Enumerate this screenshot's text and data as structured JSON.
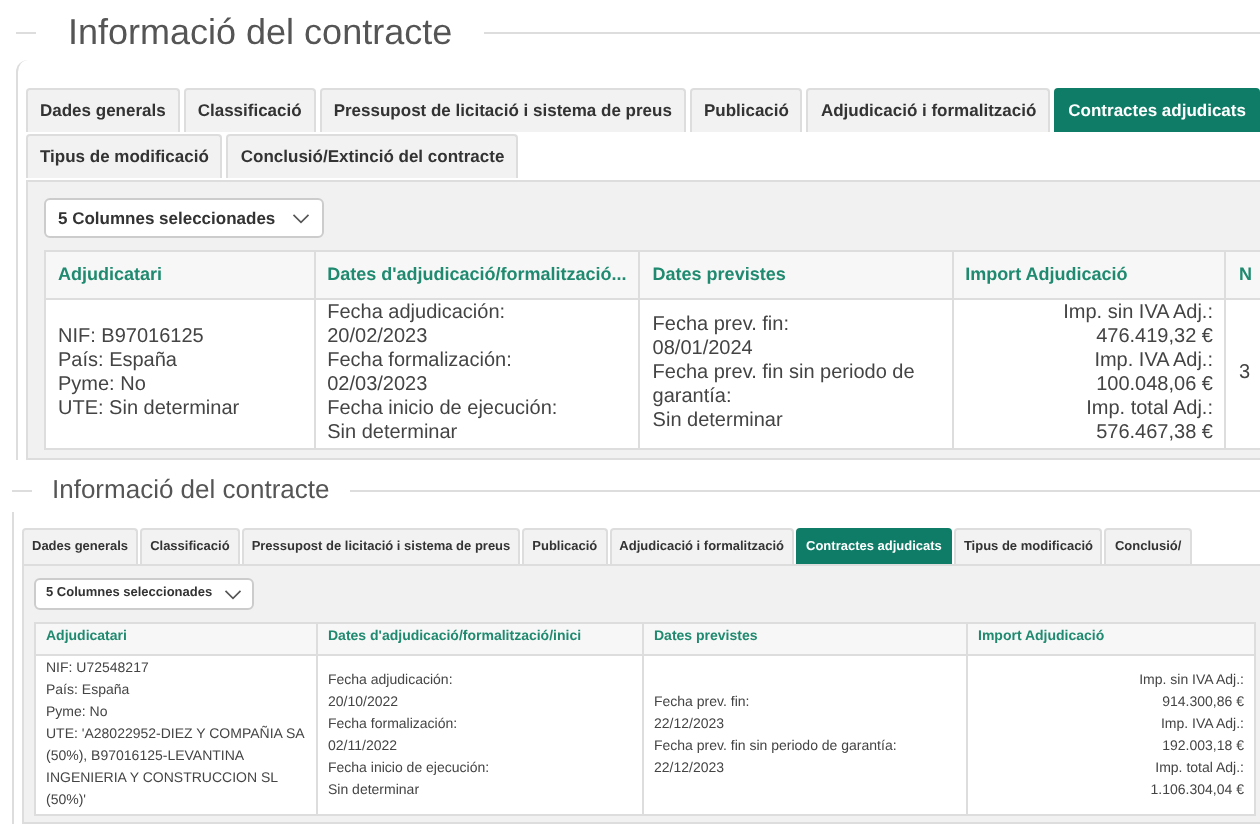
{
  "panels": [
    {
      "title": "Informació del contracte",
      "tabs": [
        {
          "label": "Dades generals",
          "selected": false
        },
        {
          "label": "Classificació",
          "selected": false
        },
        {
          "label": "Pressupost de licitació i sistema de preus",
          "selected": false
        },
        {
          "label": "Publicació",
          "selected": false
        },
        {
          "label": "Adjudicació i formalització",
          "selected": false
        },
        {
          "label": "Contractes adjudicats",
          "selected": true
        },
        {
          "label": "Tipus de modificació",
          "selected": false
        },
        {
          "label": "Conclusió/Extinció del contracte",
          "selected": false
        }
      ],
      "column_selector": "5 Columnes seleccionades",
      "table": {
        "columns": [
          "Adjudicatari",
          "Dates d'adjudicació/formalització...",
          "Dates previstes",
          "Import Adjudicació",
          "N"
        ],
        "rows": [
          [
            [
              "NIF: B97016125",
              "País: España",
              "Pyme: No",
              "UTE: Sin determinar"
            ],
            [
              "Fecha adjudicación:",
              "20/02/2023",
              "Fecha formalización:",
              "02/03/2023",
              "Fecha inicio de ejecución:",
              "Sin determinar"
            ],
            [
              "Fecha prev. fin:",
              "08/01/2024",
              "Fecha prev. fin sin periodo de garantía:",
              "Sin determinar"
            ],
            [
              "Imp. sin IVA Adj.:",
              "476.419,32 €",
              "Imp. IVA Adj.:",
              "100.048,06 €",
              "Imp. total Adj.:",
              "576.467,38 €"
            ],
            [
              "3"
            ]
          ]
        ]
      }
    },
    {
      "title": "Informació del contracte",
      "tabs": [
        {
          "label": "Dades generals",
          "selected": false
        },
        {
          "label": "Classificació",
          "selected": false
        },
        {
          "label": "Pressupost de licitació i sistema de preus",
          "selected": false
        },
        {
          "label": "Publicació",
          "selected": false
        },
        {
          "label": "Adjudicació i formalització",
          "selected": false
        },
        {
          "label": "Contractes adjudicats",
          "selected": true
        },
        {
          "label": "Tipus de modificació",
          "selected": false
        },
        {
          "label": "Conclusió/",
          "selected": false
        }
      ],
      "column_selector": "5 Columnes seleccionades",
      "table": {
        "columns": [
          "Adjudicatari",
          "Dates d'adjudicació/formalització/inici",
          "Dates previstes",
          "Import Adjudicació"
        ],
        "rows": [
          [
            [
              "NIF: U72548217",
              "País: España",
              "Pyme: No",
              "UTE: 'A28022952-DIEZ Y COMPAÑIA SA (50%), B97016125-LEVANTINA INGENIERIA Y CONSTRUCCION SL (50%)'"
            ],
            [
              "Fecha adjudicación:",
              "20/10/2022",
              "Fecha formalización:",
              "02/11/2022",
              "Fecha inicio de ejecución:",
              "Sin determinar"
            ],
            [
              "Fecha prev. fin:",
              "22/12/2023",
              "Fecha prev. fin sin periodo de garantía:",
              "22/12/2023"
            ],
            [
              "Imp. sin IVA Adj.:",
              "914.300,86 €",
              "Imp. IVA Adj.:",
              "192.003,18 €",
              "Imp. total Adj.:",
              "1.106.304,04 €"
            ]
          ]
        ]
      }
    }
  ]
}
